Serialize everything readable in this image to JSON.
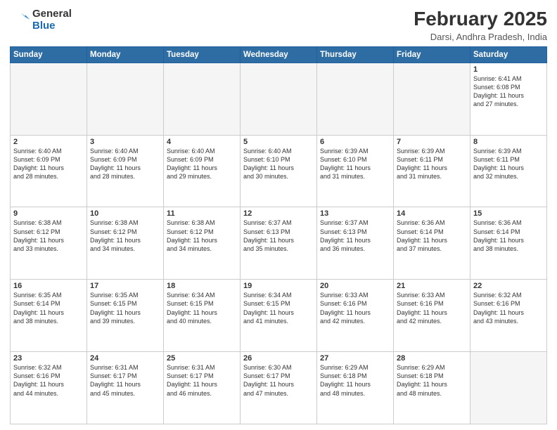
{
  "header": {
    "logo_general": "General",
    "logo_blue": "Blue",
    "month_title": "February 2025",
    "location": "Darsi, Andhra Pradesh, India"
  },
  "weekdays": [
    "Sunday",
    "Monday",
    "Tuesday",
    "Wednesday",
    "Thursday",
    "Friday",
    "Saturday"
  ],
  "weeks": [
    [
      {
        "day": "",
        "info": ""
      },
      {
        "day": "",
        "info": ""
      },
      {
        "day": "",
        "info": ""
      },
      {
        "day": "",
        "info": ""
      },
      {
        "day": "",
        "info": ""
      },
      {
        "day": "",
        "info": ""
      },
      {
        "day": "1",
        "info": "Sunrise: 6:41 AM\nSunset: 6:08 PM\nDaylight: 11 hours\nand 27 minutes."
      }
    ],
    [
      {
        "day": "2",
        "info": "Sunrise: 6:40 AM\nSunset: 6:09 PM\nDaylight: 11 hours\nand 28 minutes."
      },
      {
        "day": "3",
        "info": "Sunrise: 6:40 AM\nSunset: 6:09 PM\nDaylight: 11 hours\nand 28 minutes."
      },
      {
        "day": "4",
        "info": "Sunrise: 6:40 AM\nSunset: 6:09 PM\nDaylight: 11 hours\nand 29 minutes."
      },
      {
        "day": "5",
        "info": "Sunrise: 6:40 AM\nSunset: 6:10 PM\nDaylight: 11 hours\nand 30 minutes."
      },
      {
        "day": "6",
        "info": "Sunrise: 6:39 AM\nSunset: 6:10 PM\nDaylight: 11 hours\nand 31 minutes."
      },
      {
        "day": "7",
        "info": "Sunrise: 6:39 AM\nSunset: 6:11 PM\nDaylight: 11 hours\nand 31 minutes."
      },
      {
        "day": "8",
        "info": "Sunrise: 6:39 AM\nSunset: 6:11 PM\nDaylight: 11 hours\nand 32 minutes."
      }
    ],
    [
      {
        "day": "9",
        "info": "Sunrise: 6:38 AM\nSunset: 6:12 PM\nDaylight: 11 hours\nand 33 minutes."
      },
      {
        "day": "10",
        "info": "Sunrise: 6:38 AM\nSunset: 6:12 PM\nDaylight: 11 hours\nand 34 minutes."
      },
      {
        "day": "11",
        "info": "Sunrise: 6:38 AM\nSunset: 6:12 PM\nDaylight: 11 hours\nand 34 minutes."
      },
      {
        "day": "12",
        "info": "Sunrise: 6:37 AM\nSunset: 6:13 PM\nDaylight: 11 hours\nand 35 minutes."
      },
      {
        "day": "13",
        "info": "Sunrise: 6:37 AM\nSunset: 6:13 PM\nDaylight: 11 hours\nand 36 minutes."
      },
      {
        "day": "14",
        "info": "Sunrise: 6:36 AM\nSunset: 6:14 PM\nDaylight: 11 hours\nand 37 minutes."
      },
      {
        "day": "15",
        "info": "Sunrise: 6:36 AM\nSunset: 6:14 PM\nDaylight: 11 hours\nand 38 minutes."
      }
    ],
    [
      {
        "day": "16",
        "info": "Sunrise: 6:35 AM\nSunset: 6:14 PM\nDaylight: 11 hours\nand 38 minutes."
      },
      {
        "day": "17",
        "info": "Sunrise: 6:35 AM\nSunset: 6:15 PM\nDaylight: 11 hours\nand 39 minutes."
      },
      {
        "day": "18",
        "info": "Sunrise: 6:34 AM\nSunset: 6:15 PM\nDaylight: 11 hours\nand 40 minutes."
      },
      {
        "day": "19",
        "info": "Sunrise: 6:34 AM\nSunset: 6:15 PM\nDaylight: 11 hours\nand 41 minutes."
      },
      {
        "day": "20",
        "info": "Sunrise: 6:33 AM\nSunset: 6:16 PM\nDaylight: 11 hours\nand 42 minutes."
      },
      {
        "day": "21",
        "info": "Sunrise: 6:33 AM\nSunset: 6:16 PM\nDaylight: 11 hours\nand 42 minutes."
      },
      {
        "day": "22",
        "info": "Sunrise: 6:32 AM\nSunset: 6:16 PM\nDaylight: 11 hours\nand 43 minutes."
      }
    ],
    [
      {
        "day": "23",
        "info": "Sunrise: 6:32 AM\nSunset: 6:16 PM\nDaylight: 11 hours\nand 44 minutes."
      },
      {
        "day": "24",
        "info": "Sunrise: 6:31 AM\nSunset: 6:17 PM\nDaylight: 11 hours\nand 45 minutes."
      },
      {
        "day": "25",
        "info": "Sunrise: 6:31 AM\nSunset: 6:17 PM\nDaylight: 11 hours\nand 46 minutes."
      },
      {
        "day": "26",
        "info": "Sunrise: 6:30 AM\nSunset: 6:17 PM\nDaylight: 11 hours\nand 47 minutes."
      },
      {
        "day": "27",
        "info": "Sunrise: 6:29 AM\nSunset: 6:18 PM\nDaylight: 11 hours\nand 48 minutes."
      },
      {
        "day": "28",
        "info": "Sunrise: 6:29 AM\nSunset: 6:18 PM\nDaylight: 11 hours\nand 48 minutes."
      },
      {
        "day": "",
        "info": ""
      }
    ]
  ]
}
